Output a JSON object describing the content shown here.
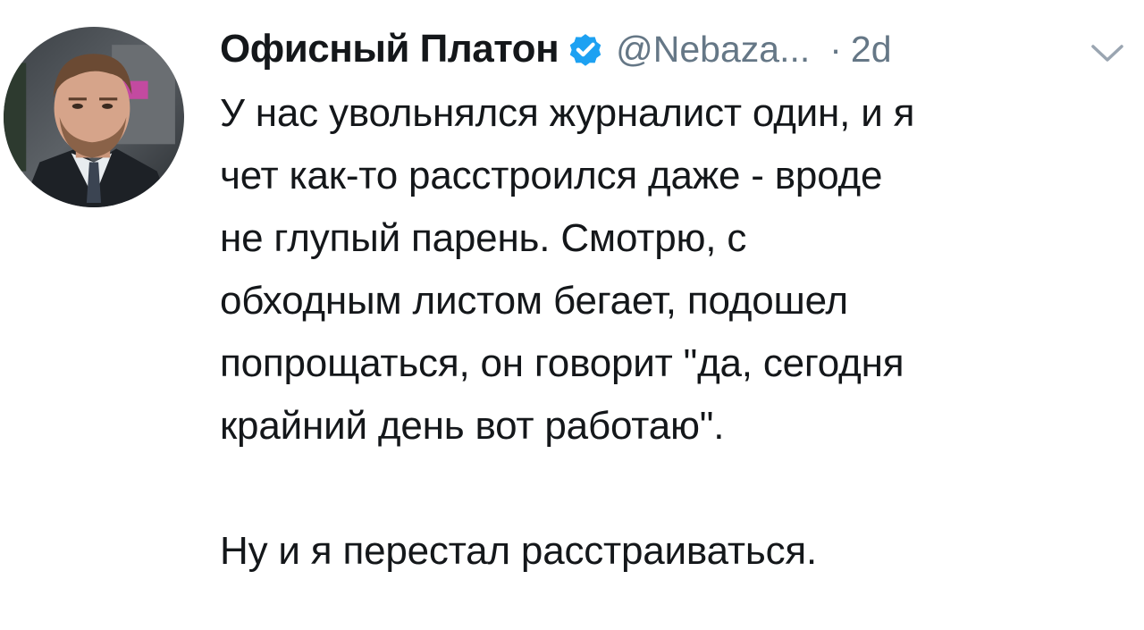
{
  "tweet": {
    "author": {
      "display_name": "Офисный Платон",
      "handle": "@Nebaza...",
      "verified": true,
      "avatar_icon": "avatar-photo"
    },
    "separator": "·",
    "time": "2d",
    "menu_icon": "chevron-down-icon",
    "text_lines": [
      "У нас увольнялся журналист один, и я",
      "чет как-то расстроился даже - вроде",
      "не глупый парень. Смотрю, с",
      "обходным листом бегает, подошел",
      "попрощаться, он говорит \"да, сегодня",
      "крайний день вот работаю\"."
    ],
    "text_final": "Ну и я перестал расстраиваться.",
    "colors": {
      "text": "#14171a",
      "secondary": "#657786",
      "verified": "#1da1f2"
    }
  }
}
